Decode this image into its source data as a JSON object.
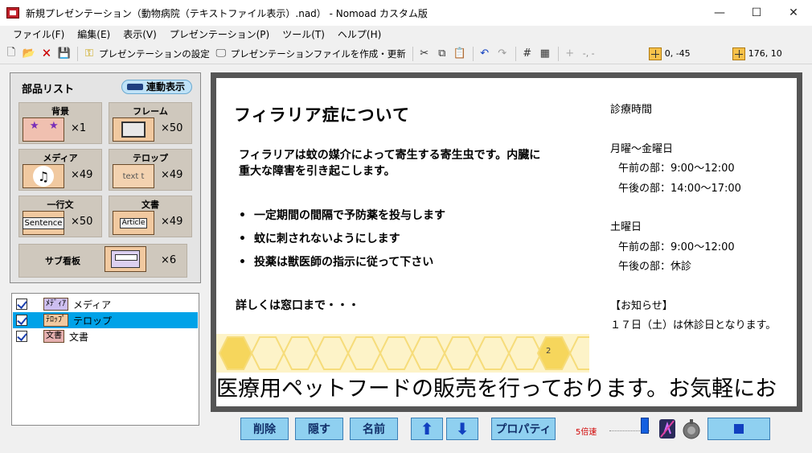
{
  "window": {
    "title": "新規プレゼンテーション（動物病院（テキストファイル表示）.nad） - Nomoad カスタム版",
    "controls": {
      "minimize": "—",
      "maximize": "☐",
      "close": "✕"
    }
  },
  "menu": [
    "ファイル(F)",
    "編集(E)",
    "表示(V)",
    "プレゼンテーション(P)",
    "ツール(T)",
    "ヘルプ(H)"
  ],
  "toolbar": {
    "presentation_settings": "プレゼンテーションの設定",
    "create_update": "プレゼンテーションファイルを作成・更新",
    "disabled_coords": "-, -",
    "position": "0, -45",
    "size": "176, 10"
  },
  "parts": {
    "title": "部品リスト",
    "link_label": "連動表示",
    "items": [
      {
        "label": "背景",
        "count": "×1"
      },
      {
        "label": "フレーム",
        "count": "×50"
      },
      {
        "label": "メディア",
        "count": "×49"
      },
      {
        "label": "テロップ",
        "count": "×49",
        "thumb": "text t"
      },
      {
        "label": "一行文",
        "count": "×50",
        "thumb": "Sentence"
      },
      {
        "label": "文書",
        "count": "×49",
        "thumb": "Article"
      },
      {
        "label": "サブ看板",
        "count": "×6"
      }
    ]
  },
  "layers": [
    {
      "tag": "ﾒﾃﾞｨｱ",
      "name": "メディア",
      "selected": false
    },
    {
      "tag": "ﾃﾛｯﾌﾟ",
      "name": "テロップ",
      "selected": true
    },
    {
      "tag": "文書",
      "name": "文書",
      "selected": false
    }
  ],
  "slide": {
    "title": "フィラリア症について",
    "body": "フィラリアは蚊の媒介によって寄生する寄生虫です。内臓に重大な障害を引き起こします。",
    "bullets": [
      "一定期間の間隔で予防薬を投与します",
      "蚊に刺されないようにします",
      "投薬は獣医師の指示に従って下さい"
    ],
    "footer": "詳しくは窓口まで・・・",
    "hours": {
      "heading": "診療時間",
      "weekday": "月曜～金曜日",
      "weekday_am": "午前の部：9:00～12:00",
      "weekday_pm": "午後の部：14:00～17:00",
      "saturday": "土曜日",
      "saturday_am": "午前の部：9:00～12:00",
      "saturday_pm": "午後の部：休診",
      "notice_heading": "【お知らせ】",
      "notice": "１７日（土）は休診日となります。"
    },
    "hex_number": "2",
    "ticker": "医療用ペットフードの販売を行っております。お気軽にお"
  },
  "controls": {
    "delete": "削除",
    "hide": "隠す",
    "rename": "名前",
    "up": "⬆",
    "down": "⬇",
    "properties": "プロパティ",
    "speed": "5倍速"
  },
  "colors": {
    "accent": "#00a2e8",
    "button_bg": "#8fd0f0",
    "speed_label": "#d00000"
  }
}
